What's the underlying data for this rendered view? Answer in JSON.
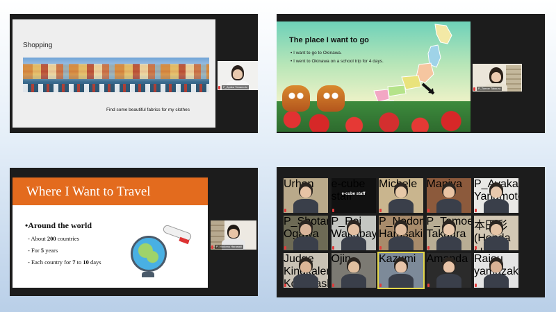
{
  "panel1": {
    "slide_title": "Shopping",
    "caption": "Find some beautiful fabrics for my clothes",
    "cam_name": "P_Ayaka Yanamoto"
  },
  "panel2": {
    "slide_title": "The place I want to go",
    "bullets": [
      "I want to go to Okinawa.",
      "I went to Okinawa on a school trip for 4 days."
    ],
    "cam_name": "P_Tomoe Takaura"
  },
  "panel3": {
    "slide_title": "Where I Want to Travel",
    "heading": "•Around the world",
    "items": [
      {
        "prefix": "- About ",
        "value": "200",
        "suffix": " countries"
      },
      {
        "prefix": "- For ",
        "value": "5",
        "suffix": " years"
      },
      {
        "prefix": "- Each country for ",
        "value": "7",
        "mid": " to ",
        "value2": "10",
        "suffix": " days"
      }
    ],
    "cam_name": "P_Nodomu Harasaki"
  },
  "gallery": {
    "participants": [
      {
        "name": "Urhon",
        "bg": "#b9a98a",
        "skin": "#e7c3a5"
      },
      {
        "name": "e-cube staff",
        "bg": "#111111",
        "skin": "",
        "label": "e-cube staff"
      },
      {
        "name": "Michele",
        "bg": "#c9b58e",
        "skin": "#e7c9a8"
      },
      {
        "name": "Maniya",
        "bg": "#8c5a3c",
        "skin": "#eac3a3"
      },
      {
        "name": "P_Ayaka Yanamoto",
        "bg": "#e9e8e5",
        "skin": "#e8c8ad"
      },
      {
        "name": "P_Shotaro Ogawa",
        "bg": "#6d6a55",
        "skin": "#d9b59a"
      },
      {
        "name": "P_Rei Wakabayashi",
        "bg": "#c4c6c2",
        "skin": "#e3c0a3"
      },
      {
        "name": "P_Nodomu Harasaki",
        "bg": "#a88b6b",
        "skin": "#e0bd9f"
      },
      {
        "name": "P_Tomoe Takaura",
        "bg": "#b8ad94",
        "skin": "#e9c9ad"
      },
      {
        "name": "本田彩 (Honda Luki)",
        "bg": "#d3c8b5",
        "skin": "#e5c4a6"
      },
      {
        "name": "Judge Kingkaler Kobayashi",
        "bg": "#c9c2b5",
        "skin": "#dcb697"
      },
      {
        "name": "Ojin",
        "bg": "#7c7a73",
        "skin": "#e0bf9f"
      },
      {
        "name": "Kazumi",
        "bg": "#7d8a99",
        "skin": "#e8c4a8"
      },
      {
        "name": "Amanda",
        "bg": "#2b2b2b",
        "skin": "#e8c3a7"
      },
      {
        "name": "Raiou yamazaki",
        "bg": "#e4e4e4",
        "skin": "#d9b295"
      }
    ]
  },
  "colors": {
    "accent_orange": "#e36b1e",
    "mic_red": "#e23b3b",
    "active_speaker": "#e5d84a"
  }
}
